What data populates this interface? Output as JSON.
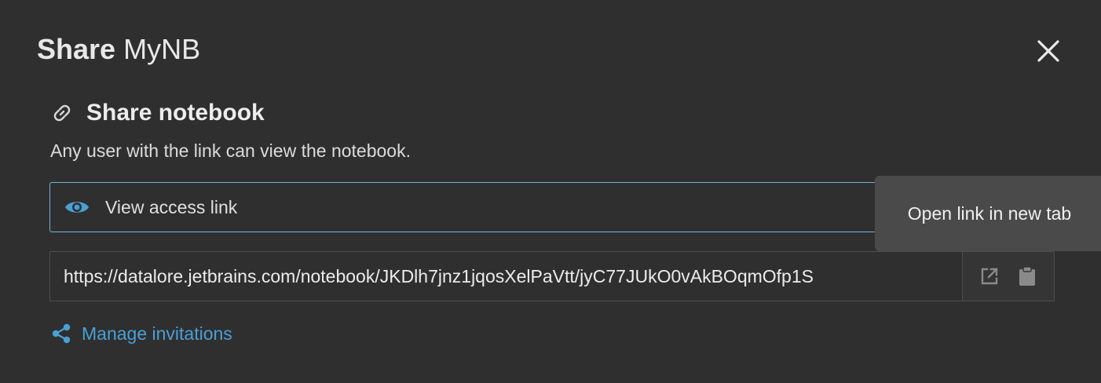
{
  "dialog": {
    "title_strong": "Share",
    "title_name": "MyNB",
    "close_icon": "close-icon"
  },
  "share_section": {
    "icon": "link-icon",
    "title": "Share notebook",
    "description": "Any user with the link can view the notebook."
  },
  "access": {
    "icon": "eye-icon",
    "selected": "View access link"
  },
  "tooltip": {
    "text": "Open link in new tab"
  },
  "link": {
    "url": "https://datalore.jetbrains.com/notebook/JKDlh7jnz1jqosXelPaVtt/jyC77JUkO0vAkBOqmOfp1S",
    "open_icon": "open-in-new-tab-icon",
    "copy_icon": "clipboard-icon"
  },
  "manage": {
    "icon": "share-icon",
    "label": "Manage invitations"
  },
  "colors": {
    "background": "#2f2f2f",
    "accent": "#4a9fd6",
    "focus_border": "#6fb6d8",
    "tooltip_bg": "#4a4a4a"
  }
}
